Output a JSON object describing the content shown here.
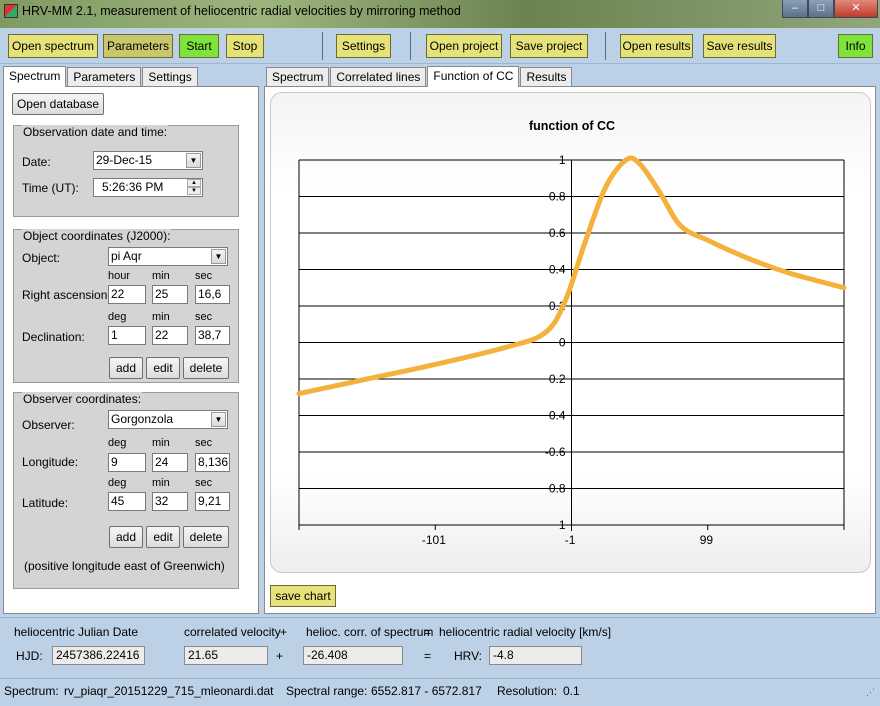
{
  "window": {
    "title": "HRV-MM 2.1,   measurement of heliocentric radial velocities by mirroring method",
    "minimize": "–",
    "maximize": "□",
    "close": "✕"
  },
  "toolbar": {
    "open_spectrum": "Open spectrum",
    "parameters": "Parameters",
    "start": "Start",
    "stop": "Stop",
    "settings": "Settings",
    "open_project": "Open project",
    "save_project": "Save project",
    "open_results": "Open results",
    "save_results": "Save results",
    "info": "Info"
  },
  "left_tabs": [
    "Spectrum",
    "Parameters",
    "Settings"
  ],
  "right_tabs": [
    "Spectrum",
    "Correlated lines",
    "Function of CC",
    "Results"
  ],
  "left": {
    "open_database": "Open database",
    "obs": {
      "title": "Observation date and time:",
      "date_label": "Date:",
      "date_value": "29-Dec-15",
      "time_label": "Time (UT):",
      "time_value": "5:26:36 PM"
    },
    "object": {
      "title": "Object coordinates (J2000):",
      "object_label": "Object:",
      "object_value": "pi Aqr",
      "ra_label": "Right ascension:",
      "ra_h_label": "hour",
      "ra_m_label": "min",
      "ra_s_label": "sec",
      "ra_h": "22",
      "ra_m": "25",
      "ra_s": "16,6",
      "dec_label": "Declination:",
      "dec_d_label": "deg",
      "dec_m_label": "min",
      "dec_s_label": "sec",
      "dec_d": "1",
      "dec_m": "22",
      "dec_s": "38,7",
      "add": "add",
      "edit": "edit",
      "delete": "delete"
    },
    "observer": {
      "title": "Observer coordinates:",
      "observer_label": "Observer:",
      "observer_value": "Gorgonzola",
      "lon_label": "Longitude:",
      "lon_d_label": "deg",
      "lon_m_label": "min",
      "lon_s_label": "sec",
      "lon_d": "9",
      "lon_m": "24",
      "lon_s": "8,136",
      "lat_label": "Latitude:",
      "lat_d_label": "deg",
      "lat_m_label": "min",
      "lat_s_label": "sec",
      "lat_d": "45",
      "lat_m": "32",
      "lat_s": "9,21",
      "add": "add",
      "edit": "edit",
      "delete": "delete",
      "note": "(positive longitude east of Greenwich)"
    }
  },
  "chart_data": {
    "type": "line",
    "title": "function of CC",
    "xlabel": "",
    "ylabel": "",
    "xlim": [
      -200,
      200
    ],
    "ylim": [
      -1,
      1
    ],
    "x_ticks": [
      -101,
      -1,
      99
    ],
    "y_tick_labels": [
      "1",
      "0.8",
      "0.6",
      "0.4",
      "0.2",
      "0",
      "0.2",
      "0.4",
      "-0.6",
      "0.8",
      "1"
    ],
    "grid": true,
    "color": "#f4b13c",
    "series": [
      {
        "x": [
          -200,
          -150,
          -100,
          -50,
          -20,
          -5,
          10,
          25,
          40,
          50,
          65,
          80,
          100,
          130,
          160,
          200
        ],
        "y": [
          -0.28,
          -0.2,
          -0.12,
          -0.03,
          0.05,
          0.22,
          0.55,
          0.85,
          1.0,
          0.98,
          0.82,
          0.64,
          0.56,
          0.46,
          0.38,
          0.3
        ]
      }
    ]
  },
  "save_chart": "save chart",
  "bottom": {
    "hjd_header": "heliocentric Julian Date",
    "corr_header": "correlated velocity",
    "plus_header": "+",
    "helcorr_header": "helioc. corr. of spectrum",
    "eq_header": "=",
    "hrv_header": "heliocentric radial velocity [km/s]",
    "hjd_label": "HJD:",
    "hjd_value": "2457386.22416",
    "corr_value": "21.65",
    "plus": "+",
    "helcorr_value": "-26.408",
    "eq": "=",
    "hrv_label": "HRV:",
    "hrv_value": "-4.8"
  },
  "status": {
    "spectrum_label": "Spectrum:",
    "spectrum_value": "rv_piaqr_20151229_715_mleonardi.dat",
    "range_label": "Spectral range:",
    "range_value": "6552.817 - 6572.817",
    "res_label": "Resolution:",
    "res_value": "0.1"
  }
}
